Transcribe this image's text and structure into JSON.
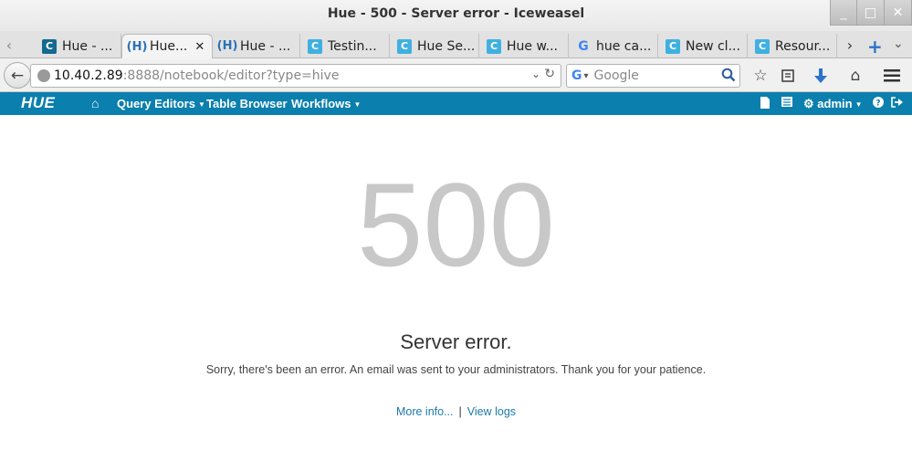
{
  "window": {
    "title": "Hue - 500 - Server error - Iceweasel",
    "minimize_glyph": "_",
    "maximize_glyph": "□",
    "close_glyph": "✕"
  },
  "tabs": [
    {
      "label": "Hue - ...",
      "icon": "c-icon-dark"
    },
    {
      "label": "Hue...",
      "icon": "hue-icon",
      "active": true
    },
    {
      "label": "Hue - ...",
      "icon": "hue-icon"
    },
    {
      "label": "Testin...",
      "icon": "c-icon"
    },
    {
      "label": "Hue Se...",
      "icon": "c-icon"
    },
    {
      "label": "Hue w...",
      "icon": "c-icon"
    },
    {
      "label": "hue ca...",
      "icon": "google-icon"
    },
    {
      "label": "New cl...",
      "icon": "c-icon"
    },
    {
      "label": "Resour...",
      "icon": "c-icon"
    }
  ],
  "navbar": {
    "url_host": "10.40.2.89",
    "url_path": ":8888/notebook/editor?type=hive",
    "search_placeholder": "Google"
  },
  "hue": {
    "logo": "HUE",
    "nav": {
      "query_editors": "Query Editors",
      "table_browser": "Table Browser",
      "workflows": "Workflows"
    },
    "user": "admin"
  },
  "error": {
    "code": "500",
    "title": "Server error.",
    "message": "Sorry, there's been an error. An email was sent to your administrators. Thank you for your patience.",
    "more_info": "More info...",
    "separator": "|",
    "view_logs": "View logs"
  },
  "colors": {
    "hue_header": "#0b7fad",
    "link": "#1b7aab",
    "code_text": "#c8c8c8"
  }
}
